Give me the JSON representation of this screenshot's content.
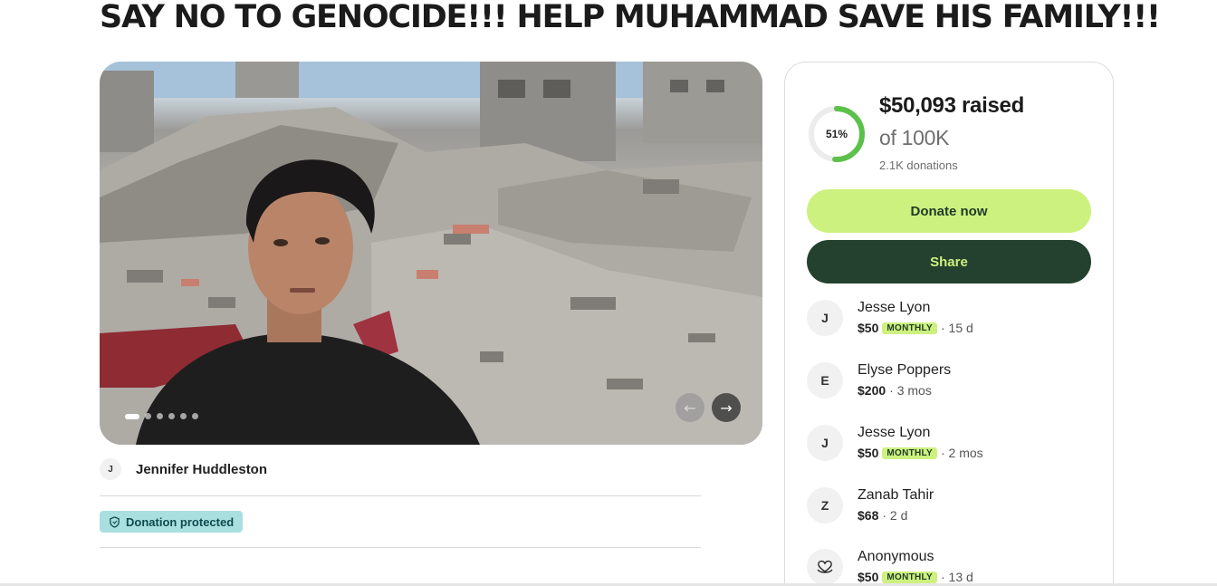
{
  "campaign": {
    "title": "SAY NO TO GENOCIDE!!! HELP MUHAMMAD SAVE HIS FAMILY!!!"
  },
  "carousel": {
    "dots": 6,
    "active_index": 0
  },
  "organizer": {
    "initial": "J",
    "name": "Jennifer Huddleston"
  },
  "badge": {
    "label": "Donation protected"
  },
  "progress": {
    "percent": 51,
    "percent_label": "51%",
    "raised": "$50,093 raised",
    "goal": "of 100K",
    "donations": "2.1K donations"
  },
  "actions": {
    "donate_label": "Donate now",
    "share_label": "Share"
  },
  "donors": [
    {
      "initial": "J",
      "name": "Jesse Lyon",
      "amount": "$50",
      "monthly": true,
      "time": "· 15 d"
    },
    {
      "initial": "E",
      "name": "Elyse Poppers",
      "amount": "$200",
      "monthly": false,
      "time": "· 3 mos"
    },
    {
      "initial": "J",
      "name": "Jesse Lyon",
      "amount": "$50",
      "monthly": true,
      "time": "· 2 mos"
    },
    {
      "initial": "Z",
      "name": "Zanab Tahir",
      "amount": "$68",
      "monthly": false,
      "time": "· 2 d"
    },
    {
      "initial": "",
      "icon": "heart-hands-icon",
      "name": "Anonymous",
      "amount": "$50",
      "monthly": true,
      "time": "· 13 d"
    }
  ],
  "monthly_label": "MONTHLY",
  "colors": {
    "accent": "#cdf17e",
    "dark_green": "#24402e",
    "ring_green": "#5cc14a",
    "badge_teal": "#a9e0df"
  }
}
